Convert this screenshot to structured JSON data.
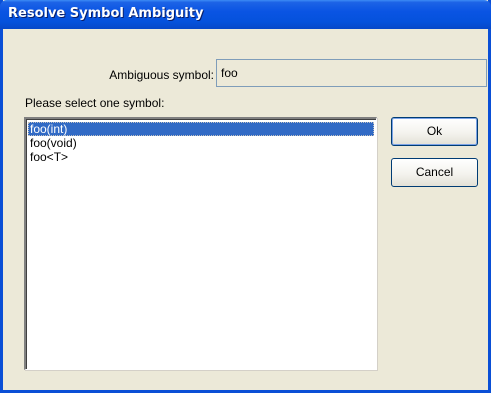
{
  "window": {
    "title": "Resolve Symbol Ambiguity"
  },
  "ambiguous": {
    "label": "Ambiguous symbol:",
    "value": "foo"
  },
  "list": {
    "label": "Please select one symbol:",
    "items": [
      "foo(int)",
      "foo(void)",
      "foo<T>"
    ],
    "selected": "foo(int)"
  },
  "buttons": {
    "ok_label": "Ok",
    "cancel_label": "Cancel"
  },
  "colors": {
    "titlebar": "#0a54e3",
    "selection": "#316ac5",
    "dialog_background": "#ece9d8"
  }
}
